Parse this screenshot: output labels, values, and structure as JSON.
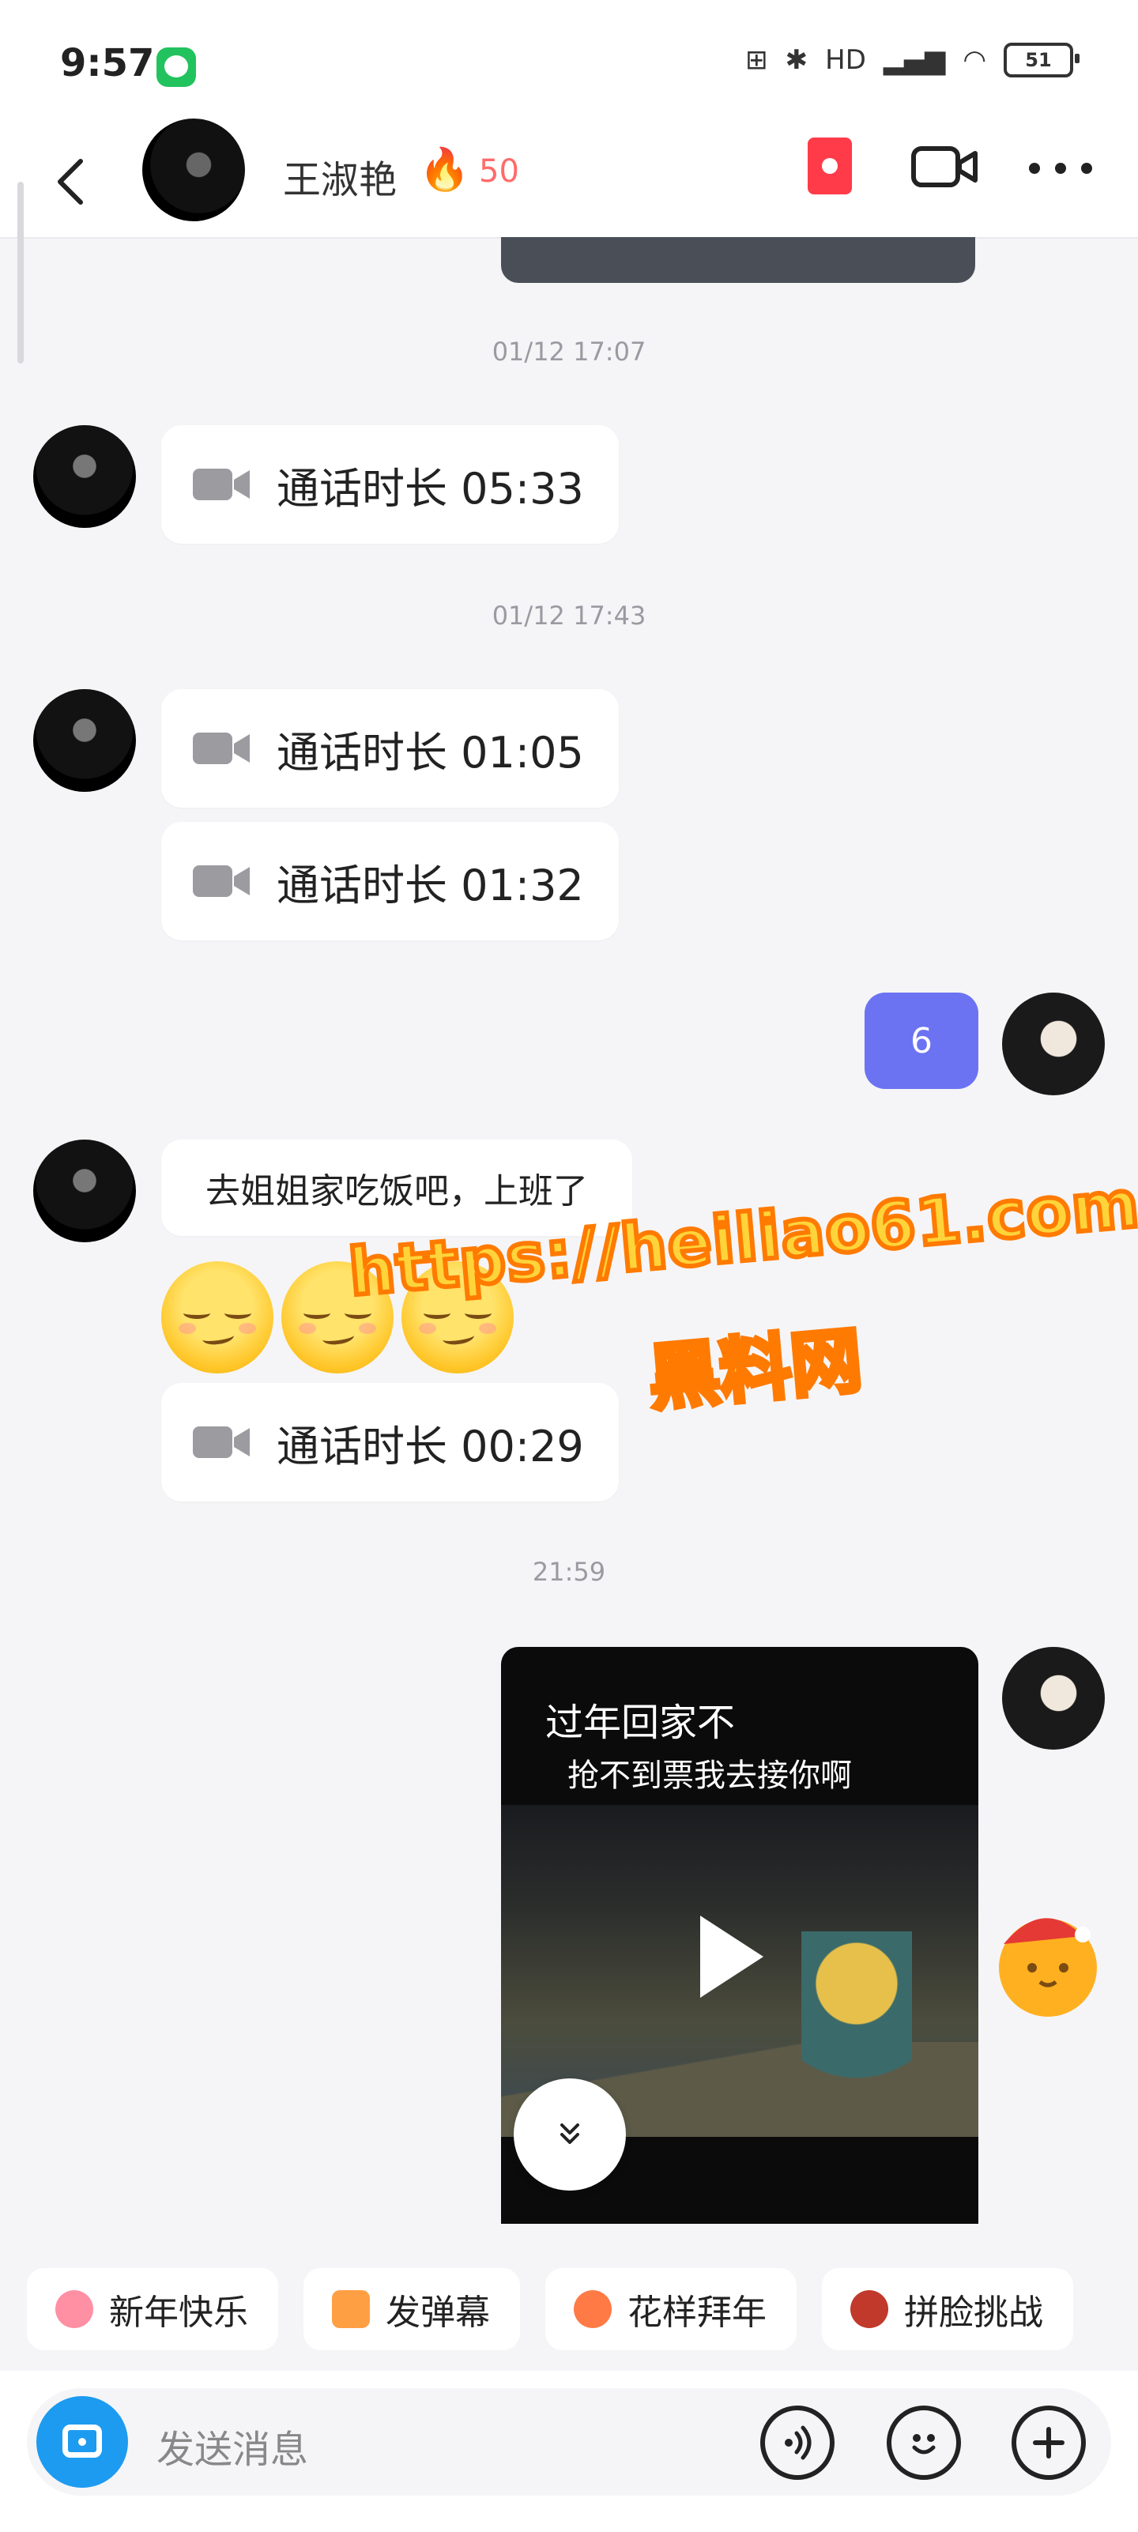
{
  "status_bar": {
    "time": "9:57",
    "signal_text": "HD",
    "battery": "51"
  },
  "header": {
    "name": "王淑艳",
    "streak_count": "50"
  },
  "messages": {
    "ts1": "01/12 17:07",
    "call1": "通话时长 05:33",
    "ts2": "01/12 17:43",
    "call2": "通话时长 01:05",
    "call3": "通话时长 01:32",
    "my_reply": "6",
    "text1": "去姐姐家吃饭吧，上班了",
    "call4": "通话时长 00:29",
    "ts3_partial": "21:59"
  },
  "watermark": {
    "url": "https://heiliao61.com",
    "name": "黑料网"
  },
  "video": {
    "title_line1": "过年回家不",
    "title_line2": "抢不到票我去接你啊"
  },
  "chips": [
    {
      "label": "新年快乐",
      "color": "#ff8fa3"
    },
    {
      "label": "发弹幕",
      "color": "#ff9f43"
    },
    {
      "label": "花样拜年",
      "color": "#ff7a45"
    },
    {
      "label": "拼脸挑战",
      "color": "#c0392b"
    }
  ],
  "input": {
    "placeholder": "发送消息"
  },
  "colors": {
    "accent": "#6b73f2",
    "camera_button": "#1d9bf0",
    "flame": "#ff4d4f"
  },
  "icons": [
    "back-icon",
    "flame-icon",
    "redpacket-icon",
    "video-call-icon",
    "more-icon",
    "video-camera-icon",
    "play-icon",
    "chevron-double-down-icon",
    "camera-icon",
    "voice-icon",
    "emoji-icon",
    "plus-icon"
  ]
}
